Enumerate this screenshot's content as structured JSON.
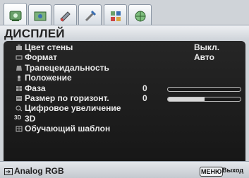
{
  "tabs": [
    {
      "icon": "display-icon",
      "active": true
    },
    {
      "icon": "picture-icon",
      "active": false
    },
    {
      "icon": "settings-icon",
      "active": false
    },
    {
      "icon": "tools-icon",
      "active": false
    },
    {
      "icon": "info-icon",
      "active": false
    },
    {
      "icon": "globe-icon",
      "active": false
    }
  ],
  "header": {
    "title": "ДИСПЛЕЙ"
  },
  "menu": {
    "items": [
      {
        "icon": "wall-color-icon",
        "label": "Цвет стены",
        "value": "Выкл."
      },
      {
        "icon": "aspect-ratio-icon",
        "label": "Формат",
        "value": "Авто"
      },
      {
        "icon": "keystone-icon",
        "label": "Трапецеидальность"
      },
      {
        "icon": "position-icon",
        "label": "Положение"
      },
      {
        "icon": "phase-icon",
        "label": "Фаза",
        "number": "0",
        "level": 0
      },
      {
        "icon": "h-size-icon",
        "label": "Размер по горизонт.",
        "number": "0",
        "level": 0.5
      },
      {
        "icon": "zoom-icon",
        "label": "Цифровое увеличение"
      },
      {
        "icon": "3d-icon",
        "label": "3D",
        "icon_text": "3D"
      },
      {
        "icon": "test-pattern-icon",
        "label": "Обучающий шаблон"
      }
    ]
  },
  "footer": {
    "source_label": "Analog RGB",
    "menu_key": "МЕНЮ",
    "exit_label": "Выход"
  },
  "colors": {
    "panel": "#1f1f1f",
    "text": "#e9e9e9",
    "header": "#dfe3e8"
  }
}
